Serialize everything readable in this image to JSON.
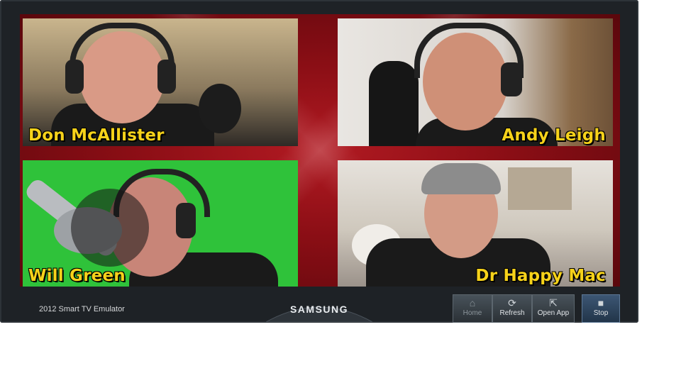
{
  "participants": [
    {
      "name": "Don McAllister"
    },
    {
      "name": "Andy Leigh"
    },
    {
      "name": "Will Green"
    },
    {
      "name": "Dr Happy Mac"
    }
  ],
  "footer": {
    "emulator_label": "2012 Smart TV Emulator",
    "brand": "SAMSUNG"
  },
  "buttons": [
    {
      "label": "Home",
      "icon": "home-icon"
    },
    {
      "label": "Refresh",
      "icon": "refresh-icon"
    },
    {
      "label": "Open App",
      "icon": "open-app-icon"
    },
    {
      "label": "Stop",
      "icon": "stop-icon"
    }
  ],
  "colors": {
    "name_text": "#f6d21a",
    "screen_background": "#8a0e15",
    "green_screen": "#2fc23a"
  }
}
